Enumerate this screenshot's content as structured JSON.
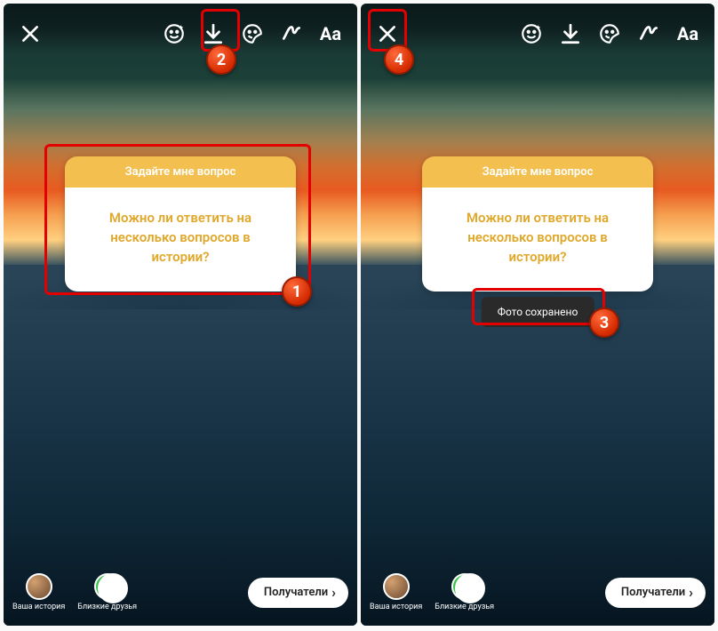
{
  "question": {
    "header": "Задайте мне вопрос",
    "body_line1": "Можно ли ответить на",
    "body_line2": "несколько вопросов в",
    "body_line3": "истории?"
  },
  "toast": "Фото сохранено",
  "bottom": {
    "your_story": "Ваша история",
    "close_friends": "Близкие друзья",
    "recipients": "Получатели"
  },
  "text_button": "Aa",
  "badges": {
    "b1": "1",
    "b2": "2",
    "b3": "3",
    "b4": "4"
  }
}
